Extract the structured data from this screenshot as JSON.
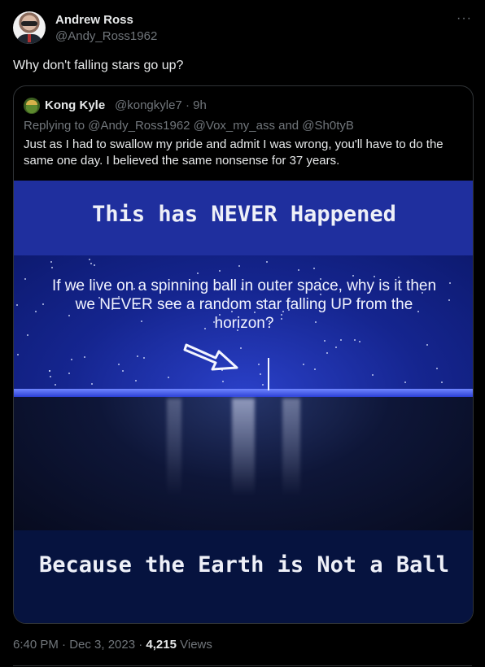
{
  "post": {
    "author_name": "Andrew Ross",
    "author_handle": "@Andy_Ross1962",
    "more_label": "···",
    "text": "Why don't falling stars go up?",
    "timestamp": "6:40 PM · Dec 3, 2023 · ",
    "views_count": "4,215",
    "views_label": " Views"
  },
  "quote": {
    "author_name": "Kong Kyle",
    "author_meta": "@kongkyle7 · 9h",
    "reply_line": "Replying to @Andy_Ross1962 @Vox_my_ass and @Sh0tyB",
    "body": "Just as I had to swallow my pride and admit I was wrong, you'll have to do the same one day. I believed the same nonsense for 37 years."
  },
  "meme": {
    "title": "This has NEVER Happened",
    "question": "If we live on a spinning ball in outer space, why is it then we NEVER see a random star falling UP from the horizon?",
    "bottom_text": "Because the Earth is Not a Ball"
  },
  "icons": {
    "author_avatar": "avatar-photo-icon",
    "quote_avatar": "frog-avatar-icon",
    "more": "more-horizontal-icon",
    "arrow": "arrow-pointing-icon"
  }
}
